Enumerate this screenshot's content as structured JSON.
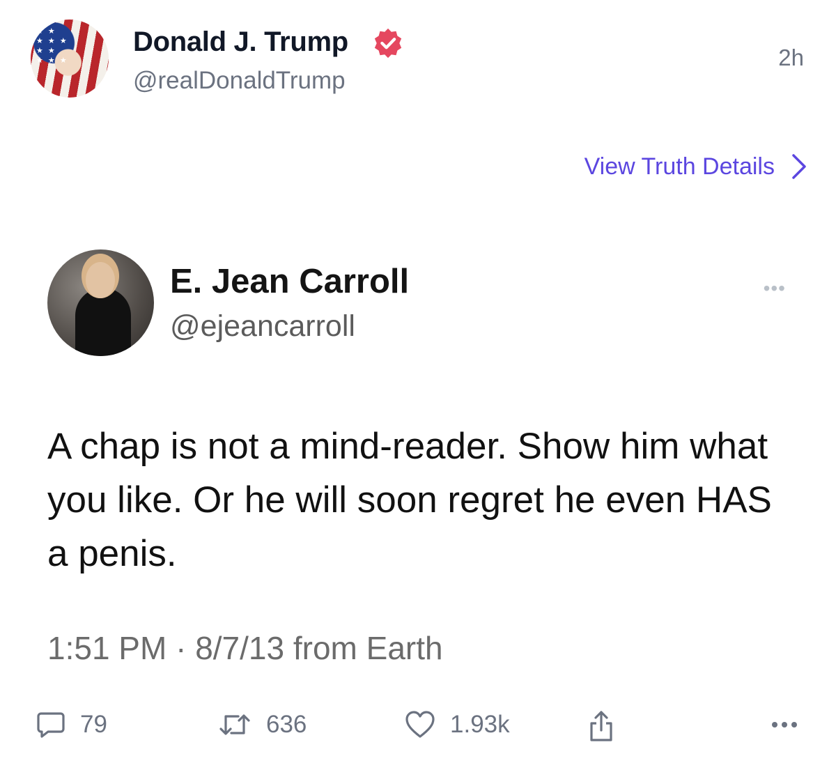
{
  "post": {
    "author_name": "Donald J. Trump",
    "author_handle": "@realDonaldTrump",
    "time_ago": "2h",
    "view_details_label": "View Truth Details"
  },
  "embed": {
    "name": "E. Jean Carroll",
    "handle": "@ejeancarroll",
    "text": "A chap is not a mind-reader. Show him what you like. Or he will soon regret he even HAS a penis.",
    "meta": "1:51 PM · 8/7/13 from Earth"
  },
  "actions": {
    "replies": "79",
    "retruths": "636",
    "likes": "1.93k"
  },
  "colors": {
    "accent": "#5b46e0",
    "verified": "#e5475f",
    "muted": "#6b7280"
  },
  "icons": [
    "verified-badge-icon",
    "chevron-right-icon",
    "more-icon",
    "reply-icon",
    "retruth-icon",
    "like-icon",
    "share-icon"
  ]
}
